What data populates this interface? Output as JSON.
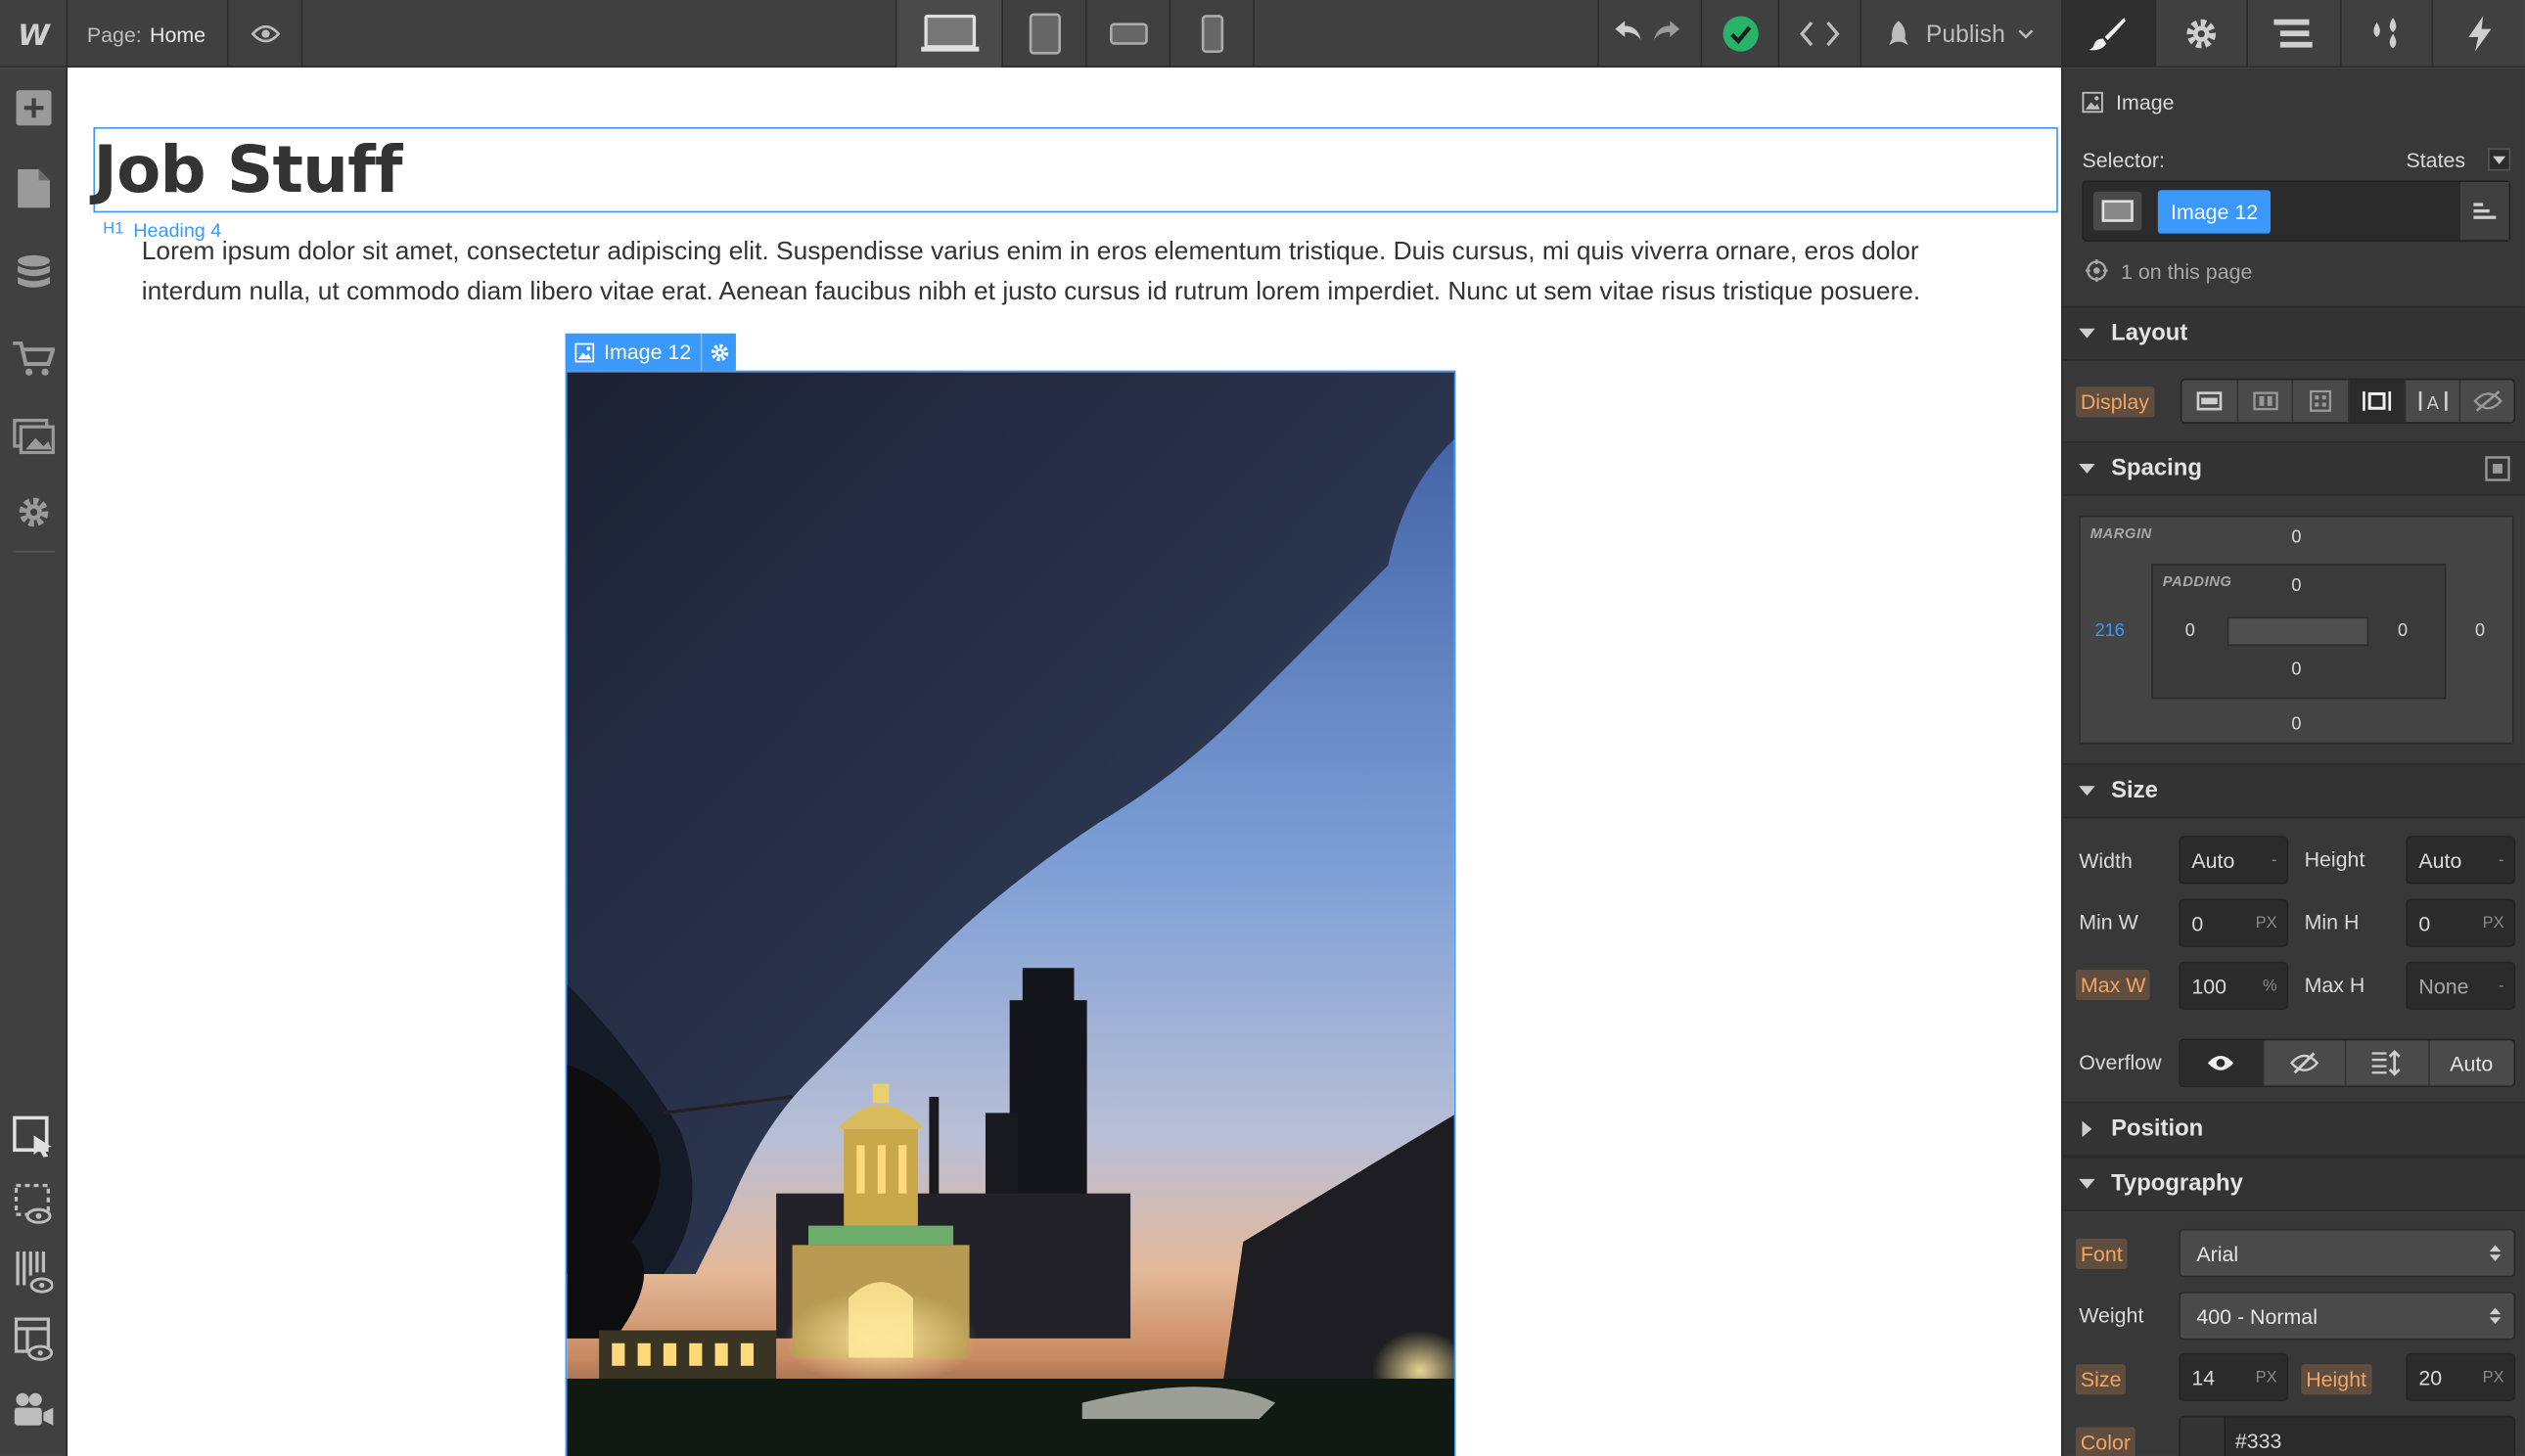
{
  "topbar": {
    "page_label": "Page:",
    "page_name": "Home",
    "publish_label": "Publish"
  },
  "canvas": {
    "heading_text": "Job Stuff",
    "heading_tag_type": "H1",
    "heading_tag_name": "Heading 4",
    "paragraph": "Lorem ipsum dolor sit amet, consectetur adipiscing elit. Suspendisse varius enim in eros elementum tristique. Duis cursus, mi quis viverra ornare, eros dolor interdum nulla, ut commodo diam libero vitae erat. Aenean faucibus nibh et justo cursus id rutrum lorem imperdiet. Nunc ut sem vitae risus tristique posuere.",
    "image_tag": "Image 12"
  },
  "panel": {
    "element_type": "Image",
    "selector_label": "Selector:",
    "states_label": "States",
    "selector_chip": "Image 12",
    "on_page": "1 on this page",
    "layout": {
      "title": "Layout",
      "display_label": "Display"
    },
    "spacing": {
      "title": "Spacing",
      "margin_label": "MARGIN",
      "padding_label": "PADDING",
      "margin_top": "0",
      "margin_left": "216",
      "margin_right": "0",
      "margin_bottom": "0",
      "padding_top": "0",
      "padding_left": "0",
      "padding_right": "0",
      "padding_bottom": "0"
    },
    "size": {
      "title": "Size",
      "width_label": "Width",
      "width_value": "Auto",
      "width_unit": "-",
      "height_label": "Height",
      "height_value": "Auto",
      "height_unit": "-",
      "minw_label": "Min W",
      "minw_value": "0",
      "minw_unit": "PX",
      "minh_label": "Min H",
      "minh_value": "0",
      "minh_unit": "PX",
      "maxw_label": "Max W",
      "maxw_value": "100",
      "maxw_unit": "%",
      "maxh_label": "Max H",
      "maxh_value": "None",
      "maxh_unit": "-",
      "overflow_label": "Overflow",
      "overflow_auto": "Auto"
    },
    "position": {
      "title": "Position"
    },
    "typography": {
      "title": "Typography",
      "font_label": "Font",
      "font_value": "Arial",
      "weight_label": "Weight",
      "weight_value": "400 - Normal",
      "size_label": "Size",
      "size_value": "14",
      "size_unit": "PX",
      "lh_label": "Height",
      "lh_value": "20",
      "lh_unit": "PX",
      "color_label": "Color",
      "color_value": "#333"
    }
  },
  "colors": {
    "accent": "#3b99fc",
    "set_property": "#f2a463",
    "success": "#27b36a"
  }
}
